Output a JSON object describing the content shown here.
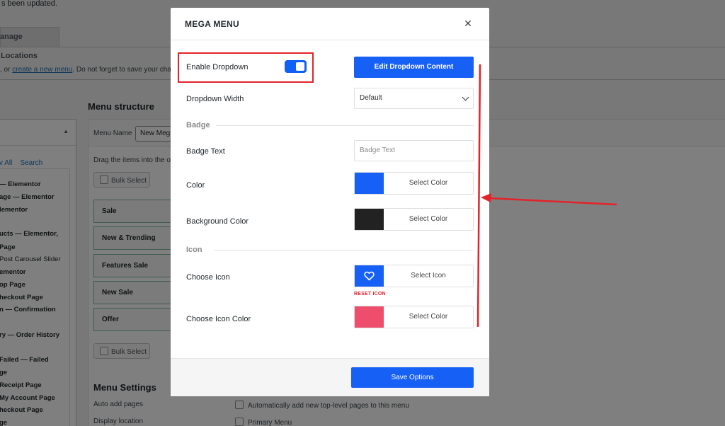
{
  "background": {
    "notice": "s been updated.",
    "tab_manage": "anage Locations",
    "helper_prefix": ", or ",
    "helper_link": "create a new menu",
    "helper_suffix": ". Do not forget to save your chan",
    "menu_structure": "Menu structure",
    "menu_name_label": "Menu Name",
    "menu_name_value": "New Meg",
    "drag_text": "Drag the items into the o",
    "bulk_select": "Bulk Select",
    "left_tabs": "v All    Search",
    "left_items": [
      "— Elementor",
      "age — Elementor",
      "lementor",
      "ucts — Elementor,",
      "Page",
      "Post Carousel Slider",
      "ementor",
      "op Page",
      "heckout Page",
      "n — Confirmation",
      "ry — Order History",
      "Failed — Failed",
      "ge",
      "Receipt Page",
      "My Account Page",
      "heckout Page",
      "ge"
    ],
    "menu_items": [
      "Sale",
      "New & Trending",
      "Features Sale",
      "New Sale",
      "Offer"
    ],
    "menu_settings": "Menu Settings",
    "auto_add_label": "Auto add pages",
    "auto_add_option": "Automatically add new top-level pages to this menu",
    "display_location_label": "Display location",
    "display_location_option": "Primary Menu"
  },
  "modal": {
    "title": "MEGA MENU",
    "close_icon": "close-icon",
    "enable_dropdown_label": "Enable Dropdown",
    "enable_dropdown_on": true,
    "edit_dropdown_button": "Edit Dropdown Content",
    "dropdown_width_label": "Dropdown Width",
    "dropdown_width_value": "Default",
    "badge_section": "Badge",
    "badge_text_label": "Badge Text",
    "badge_text_placeholder": "Badge Text",
    "color_label": "Color",
    "color_value": "#1660f5",
    "color_button": "Select Color",
    "bg_color_label": "Background Color",
    "bg_color_value": "#222222",
    "bg_color_button": "Select Color",
    "icon_section": "Icon",
    "choose_icon_label": "Choose Icon",
    "choose_icon_icon": "heart-icon",
    "choose_icon_button": "Select Icon",
    "reset_icon": "RESET ICON",
    "icon_color_label": "Choose Icon Color",
    "icon_color_value": "#ee4e6c",
    "icon_color_button": "Select Color",
    "save_button": "Save Options"
  },
  "colors": {
    "accent": "#1660f5",
    "annotation": "#e2232a"
  }
}
